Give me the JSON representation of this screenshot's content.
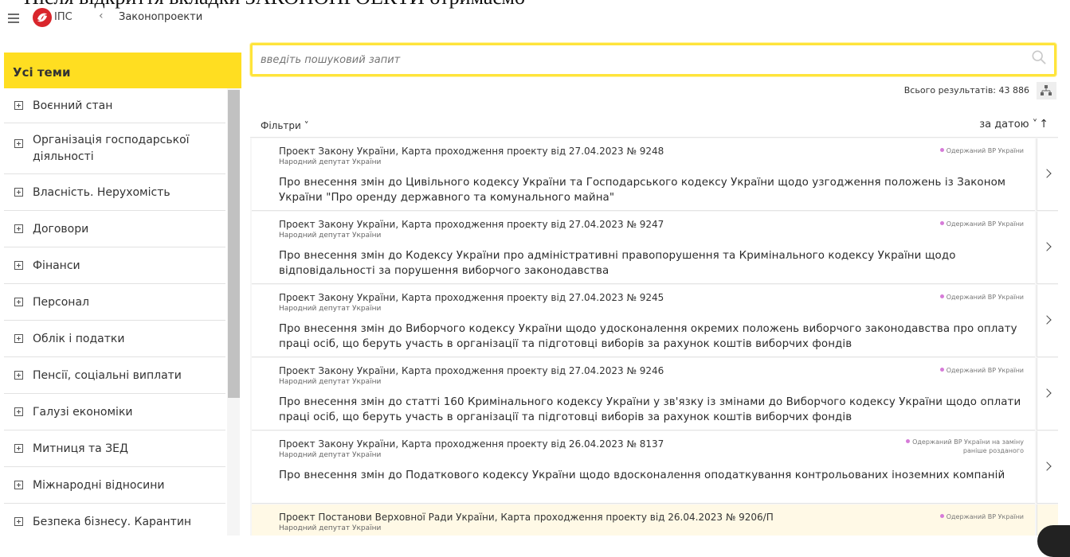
{
  "top_cut_text": "Після відкриття вкладки ЗАКОНОПРОЕКТИ отримаємо",
  "appbar": {
    "brand": "ІПС",
    "back": "‹",
    "breadcrumb": "Законопроекти"
  },
  "sidebar": {
    "header": "Усі теми",
    "items": [
      {
        "label": "Воєнний стан"
      },
      {
        "label": "Організація господарської діяльності"
      },
      {
        "label": "Власність. Нерухомість"
      },
      {
        "label": "Договори"
      },
      {
        "label": "Фінанси"
      },
      {
        "label": "Персонал"
      },
      {
        "label": "Облік і податки"
      },
      {
        "label": "Пенсії, соціальні виплати"
      },
      {
        "label": "Галузі економіки"
      },
      {
        "label": "Митниця та ЗЕД"
      },
      {
        "label": "Міжнародні відносини"
      },
      {
        "label": "Безпека бізнесу. Карантин"
      }
    ]
  },
  "search": {
    "placeholder": "введіть пошуковий запит",
    "value": ""
  },
  "results": {
    "total_label": "Всього результатів: 43 886"
  },
  "toolbar": {
    "filters_label": "Фільтри ˅",
    "sort_label": "за датою ˅",
    "sort_arrow": "↑"
  },
  "documents": [
    {
      "meta": "Проект Закону України, Карта проходження проекту від 27.04.2023 № 9248",
      "author": "Народний депутат України",
      "status": "Одержаний ВР України",
      "title": "Про внесення змін до Цивільного кодексу України та Господарського кодексу України щодо узгодження положень із Законом України \"Про оренду державного та комунального майна\""
    },
    {
      "meta": "Проект Закону України, Карта проходження проекту від 27.04.2023 № 9247",
      "author": "Народний депутат України",
      "status": "Одержаний ВР України",
      "title": "Про внесення змін до Кодексу України про адміністративні правопорушення та Кримінального кодексу України щодо відповідальності за порушення виборчого законодавства"
    },
    {
      "meta": "Проект Закону України, Карта проходження проекту від 27.04.2023 № 9245",
      "author": "Народний депутат України",
      "status": "Одержаний ВР України",
      "title": "Про внесення змін до Виборчого кодексу України щодо удосконалення окремих положень виборчого законодавства про оплату праці осіб, що беруть участь в організації та підготовці виборів за рахунок коштів виборчих фондів"
    },
    {
      "meta": "Проект Закону України, Карта проходження проекту від 27.04.2023 № 9246",
      "author": "Народний депутат України",
      "status": "Одержаний ВР України",
      "title": "Про внесення змін до статті 160 Кримінального кодексу України у зв'язку із змінами до Виборчого кодексу України щодо оплати праці осіб, що беруть участь в організації та підготовці виборів за рахунок коштів виборчих фондів"
    },
    {
      "meta": "Проект Закону України, Карта проходження проекту від 26.04.2023 № 8137",
      "author": "Народний депутат України",
      "status": "Одержаний ВР України на заміну раніше розданого",
      "title": "Про внесення змін до Податкового кодексу України щодо вдосконалення оподаткування контрольованих іноземних компаній"
    },
    {
      "meta": "Проект Постанови Верховної Ради України, Карта проходження проекту від 26.04.2023 № 9206/П",
      "author": "Народний депутат України",
      "status": "Одержаний ВР України",
      "title": ""
    }
  ],
  "colors": {
    "accent": "#ffde21",
    "search_border": "#ffe43a",
    "status_dot": "#d67bd8",
    "highlight_row": "#fff9e6",
    "logo": "#d9262c"
  },
  "icons": [
    "menu-icon",
    "ips-logo-icon",
    "search-icon",
    "tree-structure-icon",
    "chevron-right-icon",
    "expand-plus-icon"
  ]
}
